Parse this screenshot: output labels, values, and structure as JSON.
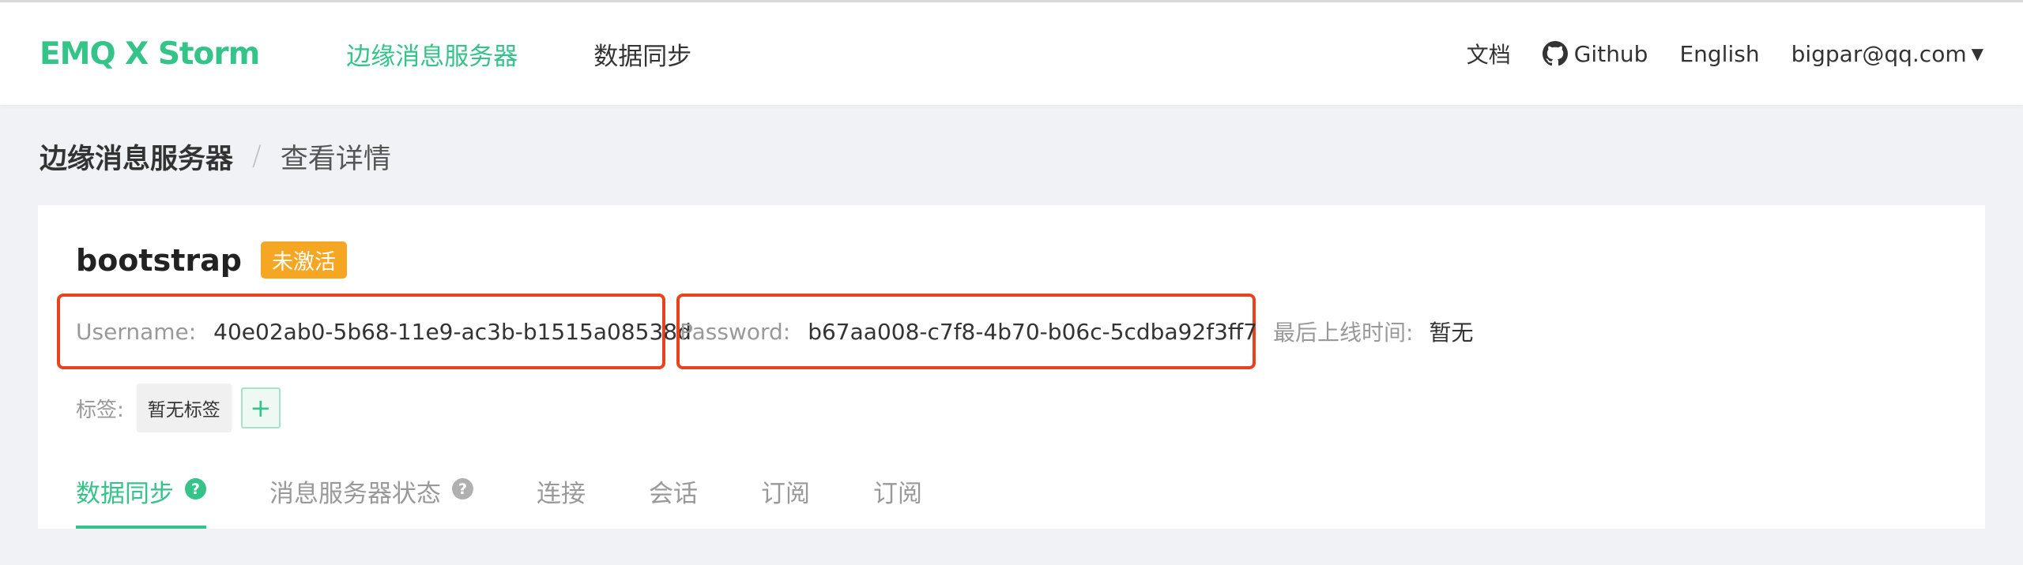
{
  "header": {
    "logo": "EMQ X Storm",
    "nav": [
      {
        "label": "边缘消息服务器"
      },
      {
        "label": "数据同步"
      }
    ],
    "docs": "文档",
    "github": "Github",
    "language": "English",
    "user": "bigpar@qq.com"
  },
  "breadcrumb": {
    "parent": "边缘消息服务器",
    "separator": "/",
    "current": "查看详情"
  },
  "server": {
    "name": "bootstrap",
    "status": "未激活",
    "username_label": "Username:",
    "username": "40e02ab0-5b68-11e9-ac3b-b1515a08538d",
    "password_label": "Password:",
    "password": "b67aa008-c7f8-4b70-b06c-5cdba92f3ff7",
    "last_online_label": "最后上线时间:",
    "last_online": "暂无",
    "tags_label": "标签:",
    "tags_empty": "暂无标签",
    "add_tag": "+"
  },
  "tabs": [
    {
      "label": "数据同步"
    },
    {
      "label": "消息服务器状态"
    },
    {
      "label": "连接"
    },
    {
      "label": "会话"
    },
    {
      "label": "订阅"
    },
    {
      "label": "订阅"
    }
  ],
  "colors": {
    "accent": "#34c388",
    "badge": "#f5a623",
    "highlight_box": "#e8421f"
  }
}
